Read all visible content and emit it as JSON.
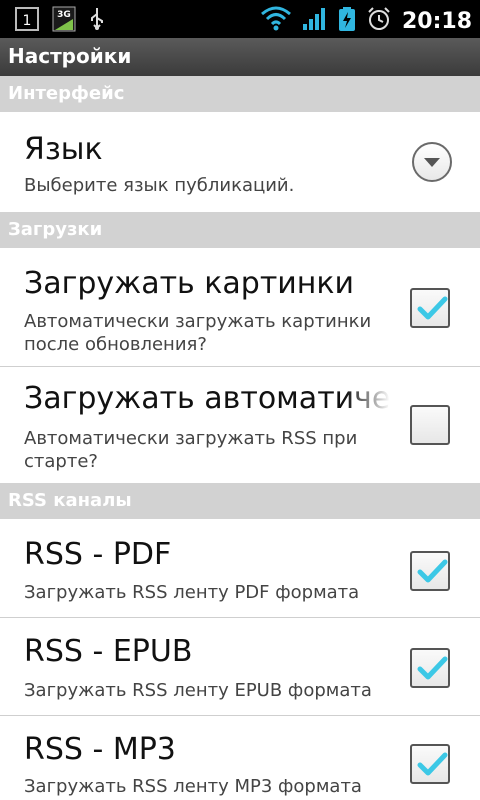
{
  "statusbar": {
    "time": "20:18",
    "left_icons": [
      "notification-icon",
      "3g-icon",
      "usb-icon"
    ],
    "right_icons": [
      "wifi-icon",
      "signal-icon",
      "battery-charging-icon",
      "alarm-icon"
    ],
    "net_label": "3G"
  },
  "titlebar": {
    "title": "Настройки"
  },
  "sections": [
    {
      "label": "Интерфейс"
    },
    {
      "label": "Загрузки"
    },
    {
      "label": "RSS каналы"
    }
  ],
  "items": [
    {
      "title": "Язык",
      "subtitle": "Выберите язык публикаций.",
      "control": "dropdown"
    },
    {
      "title": "Загружать картинки",
      "subtitle": "Автоматически загружать картинки после обновления?",
      "control": "checkbox",
      "checked": true
    },
    {
      "title": "Загружать автоматически",
      "subtitle": "Автоматически загружать RSS при старте?",
      "control": "checkbox",
      "checked": false
    },
    {
      "title": "RSS - PDF",
      "subtitle": "Загружать RSS ленту PDF формата",
      "control": "checkbox",
      "checked": true
    },
    {
      "title": "RSS - EPUB",
      "subtitle": "Загружать RSS ленту EPUB формата",
      "control": "checkbox",
      "checked": true
    },
    {
      "title": "RSS - MP3",
      "subtitle": "Загружать RSS ленту MP3 формата",
      "control": "checkbox",
      "checked": true
    }
  ],
  "colors": {
    "accent_check": "#3cc8e6",
    "section_bg": "#d2d2d2"
  }
}
